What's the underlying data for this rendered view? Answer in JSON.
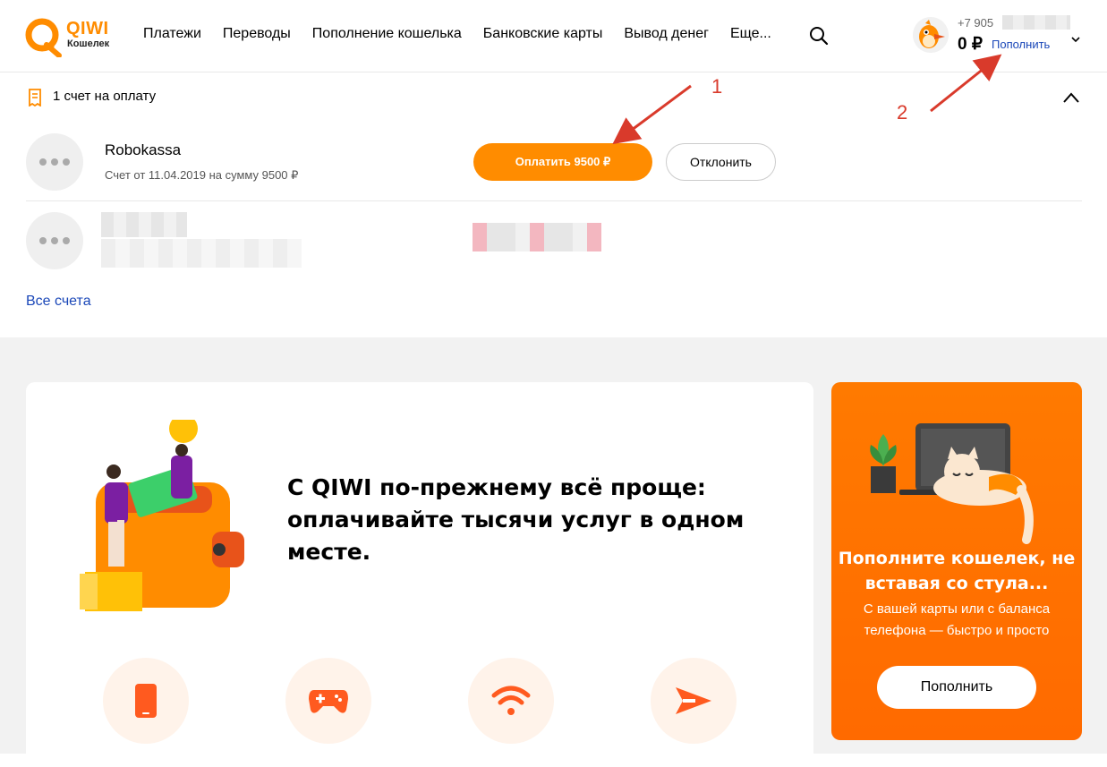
{
  "brand": {
    "logo_text": "QIWI",
    "logo_sub": "Кошелек",
    "accent": "#ff8c00",
    "link_color": "#1a47b8"
  },
  "nav": [
    "Платежи",
    "Переводы",
    "Пополнение кошелька",
    "Банковские карты",
    "Вывод денег",
    "Еще..."
  ],
  "account": {
    "phone_prefix": "+7 905",
    "balance": "0 ₽",
    "topup_label": "Пополнить"
  },
  "bills": {
    "title": "1 счет на оплату",
    "items": [
      {
        "name": "Robokassa",
        "desc": "Счет от 11.04.2019 на сумму 9500 ₽",
        "pay_label": "Оплатить 9500 ₽",
        "decline_label": "Отклонить"
      }
    ],
    "all_link": "Все счета"
  },
  "promo": {
    "text": "С QIWI по-прежнему всё проще: оплачивайте тысячи услуг в одном месте."
  },
  "categories": [
    {
      "icon": "phone-icon"
    },
    {
      "icon": "gamepad-icon"
    },
    {
      "icon": "wifi-icon"
    },
    {
      "icon": "transfer-arrow-icon"
    }
  ],
  "topup_card": {
    "title": "Пополните кошелек, не вставая со стула...",
    "desc": "С вашей карты или с баланса телефона — быстро и просто",
    "button": "Пополнить"
  },
  "annotations": {
    "marker_1": "1",
    "marker_2": "2"
  }
}
